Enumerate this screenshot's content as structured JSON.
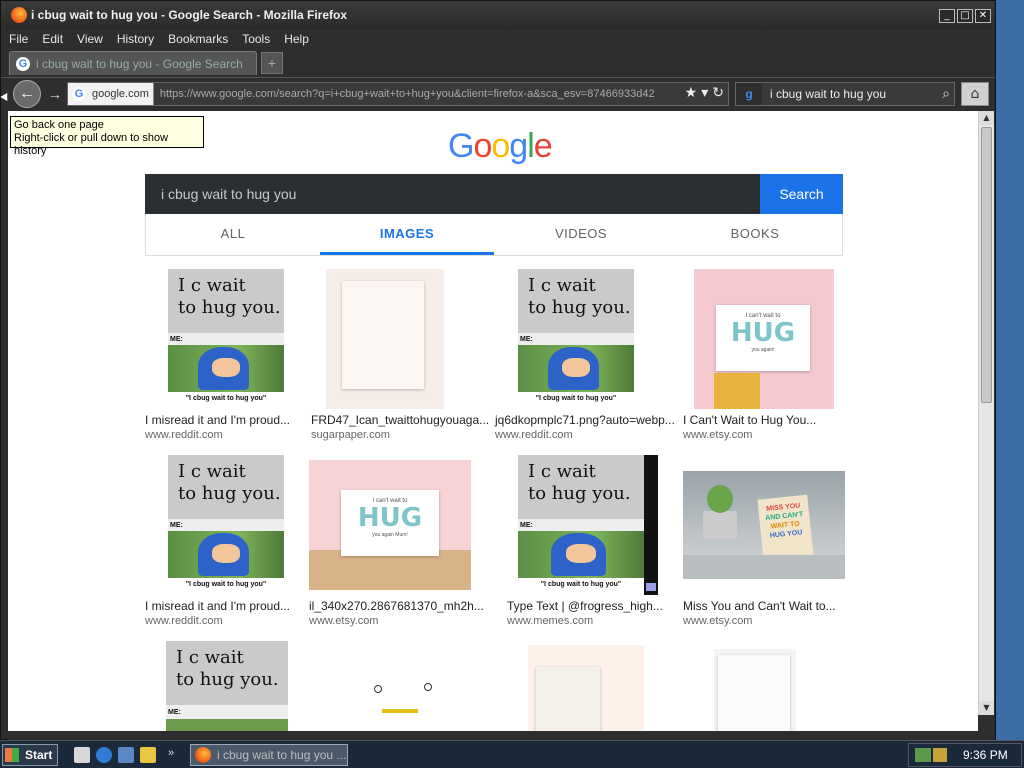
{
  "window": {
    "title": "i cbug wait to hug you - Google Search - Mozilla Firefox"
  },
  "menu": [
    "File",
    "Edit",
    "View",
    "History",
    "Bookmarks",
    "Tools",
    "Help"
  ],
  "tab": {
    "label": "i cbug wait to hug you - Google Search",
    "new_tab": "+"
  },
  "nav": {
    "site_identity": "google.com",
    "url": "https://www.google.com/search?q=i+cbug+wait+to+hug+you&client=firefox-a&sca_esv=87466933d42",
    "search_value": "i cbug wait to hug you",
    "tooltip_line1": "Go back one page",
    "tooltip_line2": "Right-click or pull down to show history"
  },
  "google": {
    "query": "i cbug wait to hug you",
    "search_button": "Search",
    "tabs": [
      {
        "label": "ALL",
        "active": false
      },
      {
        "label": "IMAGES",
        "active": true
      },
      {
        "label": "VIDEOS",
        "active": false
      },
      {
        "label": "BOOKS",
        "active": false
      }
    ],
    "results": [
      {
        "title": "I misread it and I'm proud...",
        "domain": "www.reddit.com",
        "kind": "meme"
      },
      {
        "title": "FRD47_Ican_twaittohugyouaga...",
        "domain": "sugarpaper.com",
        "kind": "card"
      },
      {
        "title": "jq6dkopmplc71.png?auto=webp...",
        "domain": "www.reddit.com",
        "kind": "meme"
      },
      {
        "title": "I Can't Wait to Hug You...",
        "domain": "www.etsy.com",
        "kind": "hug-pink"
      },
      {
        "title": "I misread it and I'm proud...",
        "domain": "www.reddit.com",
        "kind": "meme"
      },
      {
        "title": "il_340x270.2867681370_mh2h...",
        "domain": "www.etsy.com",
        "kind": "hug-card"
      },
      {
        "title": "Type Text | @frogress_high...",
        "domain": "www.memes.com",
        "kind": "meme"
      },
      {
        "title": "Miss You and Can't Wait to...",
        "domain": "www.etsy.com",
        "kind": "miss-you"
      }
    ],
    "meme": {
      "top_line1": "I c wait",
      "top_line2": "to hug you.",
      "me_label": "ME:",
      "caption": "\"I cbug wait to hug you\""
    },
    "hug_card": {
      "small": "I can't wait to",
      "big": "HUG",
      "bottom": "you again!"
    },
    "hug_card_5": {
      "small": "I can't wait to",
      "big": "HUG",
      "bottom": "you again Mum!"
    },
    "miss_you_card": {
      "line1": "MISS YOU",
      "line2": "AND CAN'T",
      "line3": "WAIT TO",
      "line4": "HUG YOU"
    }
  },
  "taskbar": {
    "start": "Start",
    "task_label": "i cbug wait to hug you ...",
    "clock": "9:36 PM"
  },
  "colors": {
    "google_blue": "#4285f4",
    "google_red": "#ea4335",
    "google_yellow": "#fbbc05",
    "google_green": "#34a853",
    "active_tab": "#1a73e8"
  }
}
